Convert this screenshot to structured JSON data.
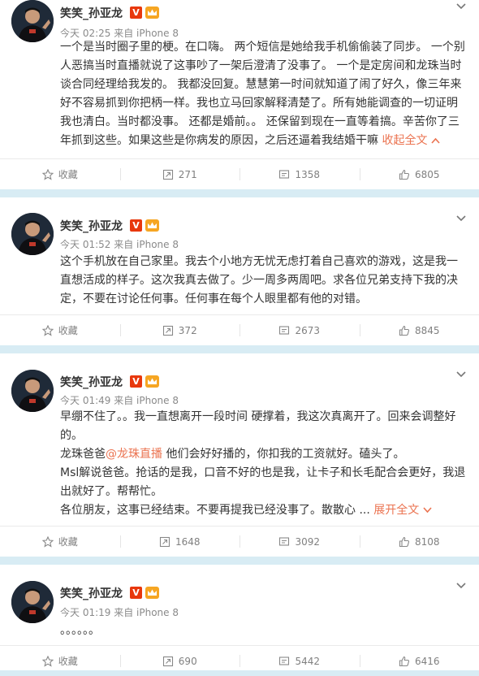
{
  "posts": [
    {
      "author": "笑笑_孙亚龙",
      "meta": "今天 02:25 来自 iPhone 8",
      "lines": [
        "一个是当时圈子里的梗。在口嗨。 两个短信是她给我手机偷偷装了同步。 一个别",
        "人恶搞当时直播就说了这事吵了一架后澄清了没事了。 一个是定房间和龙珠当时",
        "谈合同经理给我发的。 我都没回复。慧慧第一时间就知道了闹了好久，像三年来",
        "好不容易抓到你把柄一样。我也立马回家解释清楚了。所有她能调查的一切证明",
        "我也清白。当时都没事。 还都是婚前。。 还保留到现在一直等着搞。辛苦你了三",
        "年抓到这些。如果这些是你病发的原因，之后还逼着我结婚干嘛 "
      ],
      "toggle": "收起全文",
      "actions": {
        "fav": "收藏",
        "repost": "271",
        "comment": "1358",
        "like": "6805"
      }
    },
    {
      "author": "笑笑_孙亚龙",
      "meta": "今天 01:52 来自 iPhone 8",
      "lines": [
        "这个手机放在自己家里。我去个小地方无忧无虑打着自己喜欢的游戏，这是我一",
        "直想活成的样子。这次我真去做了。少一周多两周吧。求各位兄弟支持下我的决",
        "定，不要在讨论任何事。任何事在每个人眼里都有他的对错。"
      ],
      "actions": {
        "fav": "收藏",
        "repost": "372",
        "comment": "2673",
        "like": "8845"
      }
    },
    {
      "author": "笑笑_孙亚龙",
      "meta": "今天 01:49 来自 iPhone 8",
      "lines": [
        "早绷不住了。。我一直想离开一段时间 硬撑着，我这次真离开了。回来会调整好",
        "的。"
      ],
      "line3_prefix": "龙珠爸爸",
      "line3_link": "@龙珠直播",
      "line3_suffix": " 他们会好好播的，你扣我的工资就好。磕头了。",
      "lines_b": [
        "Msl解说爸爸。抢话的是我，口音不好的也是我，让卡子和长毛配合会更好，我退",
        "出就好了。帮帮忙。",
        "各位朋友，这事已经结束。不要再提我已经没事了。散散心 ... "
      ],
      "toggle": "展开全文",
      "actions": {
        "fav": "收藏",
        "repost": "1648",
        "comment": "3092",
        "like": "8108"
      }
    },
    {
      "author": "笑笑_孙亚龙",
      "meta": "今天 01:19 来自 iPhone 8",
      "lines": [
        "。。。。。。"
      ],
      "actions": {
        "fav": "收藏",
        "repost": "690",
        "comment": "5442",
        "like": "6416"
      }
    }
  ],
  "colors": {
    "accent": "#eb7350",
    "verified": "#e8380d",
    "background": "#d8ecf4"
  }
}
